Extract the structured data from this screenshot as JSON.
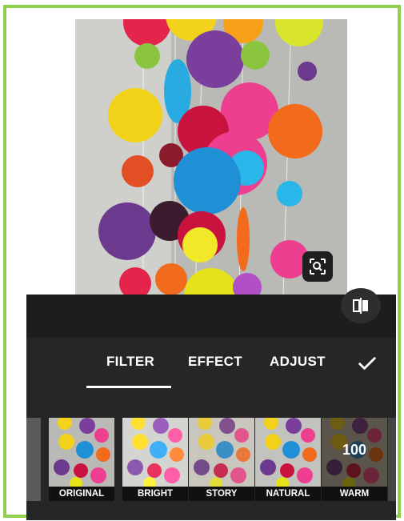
{
  "photo": {
    "zoom_icon": "zoom-scan-icon"
  },
  "editor": {
    "compare_icon": "compare-split-icon",
    "tabs": [
      {
        "label": "FILTER",
        "active": true
      },
      {
        "label": "EFFECT",
        "active": false
      },
      {
        "label": "ADJUST",
        "active": false
      }
    ],
    "confirm_icon": "checkmark-icon",
    "filters": [
      {
        "label": "ORIGINAL"
      },
      {
        "label": "BRIGHT"
      },
      {
        "label": "STORY"
      },
      {
        "label": "NATURAL"
      },
      {
        "label": "WARM",
        "value": "100"
      }
    ]
  },
  "colors": {
    "frame": "#8fd14f",
    "editor_bg": "#262626",
    "label_bg": "#111111"
  }
}
